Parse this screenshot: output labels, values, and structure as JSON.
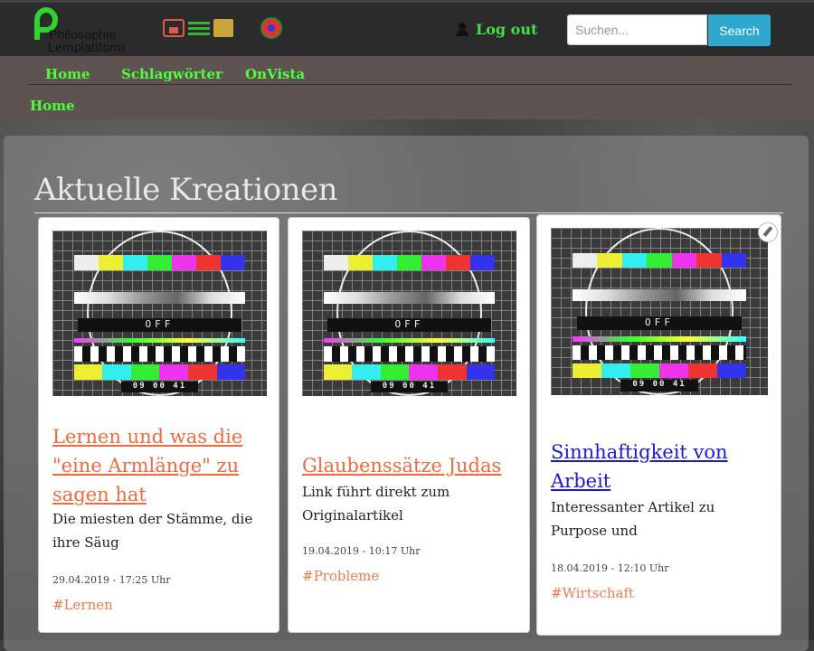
{
  "header": {
    "logo_line1": "Philosophie",
    "logo_line2": "Lernplattform",
    "logout_label": "Log out",
    "search_placeholder": "Suchen...",
    "search_button": "Search"
  },
  "quick_icons": [
    "images-icon",
    "list-icon",
    "scroll-icon",
    "ufo-icon"
  ],
  "nav": {
    "items": [
      {
        "label": "Home"
      },
      {
        "label": "Schlagwörter"
      },
      {
        "label": "OnVista"
      }
    ],
    "breadcrumb": "Home"
  },
  "main": {
    "heading": "Aktuelle Kreationen",
    "cards": [
      {
        "title": "Lernen und was die \"eine Armlänge\" zu sagen hat",
        "description": "Die miesten der Stämme, die ihre Säug",
        "date": "29.04.2019 - 17:25 Uhr",
        "tag": "#Lernen",
        "image": {
          "off_label": "OFF",
          "time_label": "09 00 41"
        }
      },
      {
        "title": "Glaubenssätze Judas",
        "description": "Link führt direkt zum Originalartikel",
        "date": "19.04.2019 - 10:17 Uhr",
        "tag": "#Probleme",
        "image": {
          "off_label": "OFF",
          "time_label": "09 00 41"
        }
      },
      {
        "title": "Sinnhaftigkeit von Arbeit",
        "description": "Interessanter Artikel zu Purpose und",
        "date": "18.04.2019 - 12:10 Uhr",
        "tag": "#Wirtschaft",
        "image": {
          "off_label": "OFF",
          "time_label": "09 00 41"
        }
      }
    ]
  },
  "colors": {
    "nav_link": "#4cff3a",
    "card_link": "#f26a3c",
    "card_link_visited": "#1a1ad8",
    "search_button_bg": "#2fa8d0"
  }
}
